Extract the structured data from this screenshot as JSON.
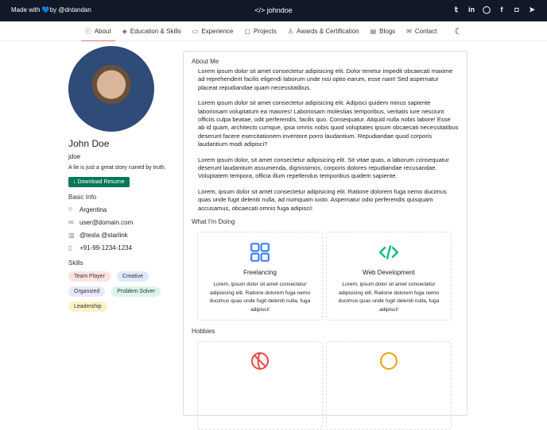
{
  "topbar": {
    "made_with": "Made with",
    "heart": "💙",
    "by": "by @dntandan",
    "brand_icon": "</>",
    "brand": "johndoe",
    "social": [
      "twitter-icon",
      "linkedin-icon",
      "github-icon",
      "facebook-icon",
      "instagram-icon",
      "telegram-icon"
    ]
  },
  "nav": [
    {
      "label": "About",
      "icon": "ⓘ"
    },
    {
      "label": "Education & Skills",
      "icon": "◈"
    },
    {
      "label": "Experience",
      "icon": "▭"
    },
    {
      "label": "Projects",
      "icon": "▢"
    },
    {
      "label": "Awards & Certification",
      "icon": "♙"
    },
    {
      "label": "Blogs",
      "icon": "▤"
    },
    {
      "label": "Contact",
      "icon": "✉"
    }
  ],
  "profile": {
    "name": "John Doe",
    "username": "jdoe",
    "bio": "A lie is just a great story ruined by truth.",
    "download": "↓ Download Resume",
    "basic_info": "Basic Info",
    "location": "Argentina",
    "email": "user@domain.com",
    "work": "@tesla @starlink",
    "phone": "+91-99-1234-1234",
    "skills_title": "Skills",
    "skills": [
      {
        "label": "Team Player",
        "color": "#fde2e2"
      },
      {
        "label": "Creative",
        "color": "#e0e9fb"
      },
      {
        "label": "Organized",
        "color": "#ebe7fb"
      },
      {
        "label": "Problem Solver",
        "color": "#dcf5e8"
      },
      {
        "label": "Leadership",
        "color": "#fdf2c7"
      }
    ]
  },
  "about": {
    "title": "About Me",
    "paragraphs": [
      "Lorem ipsum dolor sit amet consectetur adipisicing elit. Dolor tenetur impedit obcaecati maxime ad reprehenderit facilis eligendi laborum unde nisi optio earum, esse nam! Sed aspernatur placeat repudiandae quam necessitatibus.",
      "Lorem ipsum dolor sit amet consectetur adipisicing elit. Adipisci quidem minus sapiente laboriosam voluptatum ea maiores! Laboriosam molestias temporibus, veritatis iure nesciunt officiis culpa beatae, odit perferendis, facilis quo. Consequatur. Aliquid nulla nobis labore! Esse ab id quam, architecto cumque, ipsa omnis nobis quod voluptates ipsum obcaecati necessitatibus deserunt facere exercitationem inventore porro laudantium. Repudiandae quod corporis laudantium modi adipisci?",
      "Lorem ipsum dolor, sit amet consectetur adipisicing elit. Sit vitae quas, a laborum consequatur deserunt laudantium assumenda, dignissimos, corporis dolores repudiandae recusandae. Voluptatem tempora, officia illum repellendus temporibus quidem sapiente.",
      "Lorem, ipsum dolor sit amet consectetur adipisicing elit. Ratione dolorem fuga nemo ducimus quas unde fugit deleniti nulla, ad numquam iusto. Aspernatur odio perferendis quisquam accusamus, obcaecati omnis fuga adipisci!"
    ]
  },
  "doing": {
    "title": "What I'm Doing",
    "items": [
      {
        "title": "Freelancing",
        "desc": "Lorem, ipsum dolor sit amet consectetur adipisicing elit. Ratione dolorem fuga nemo ducimus quas unde fugit deleniti nulla, fuga adipisci!",
        "color": "#3b82f6"
      },
      {
        "title": "Web Development",
        "desc": "Lorem, ipsum dolor sit amet consectetur adipisicing elit. Ratione dolorem fuga nemo ducimus quas unde fugit deleniti nulla, fuga adipisci!",
        "color": "#10b981"
      }
    ]
  },
  "hobbies": {
    "title": "Hobbies"
  }
}
